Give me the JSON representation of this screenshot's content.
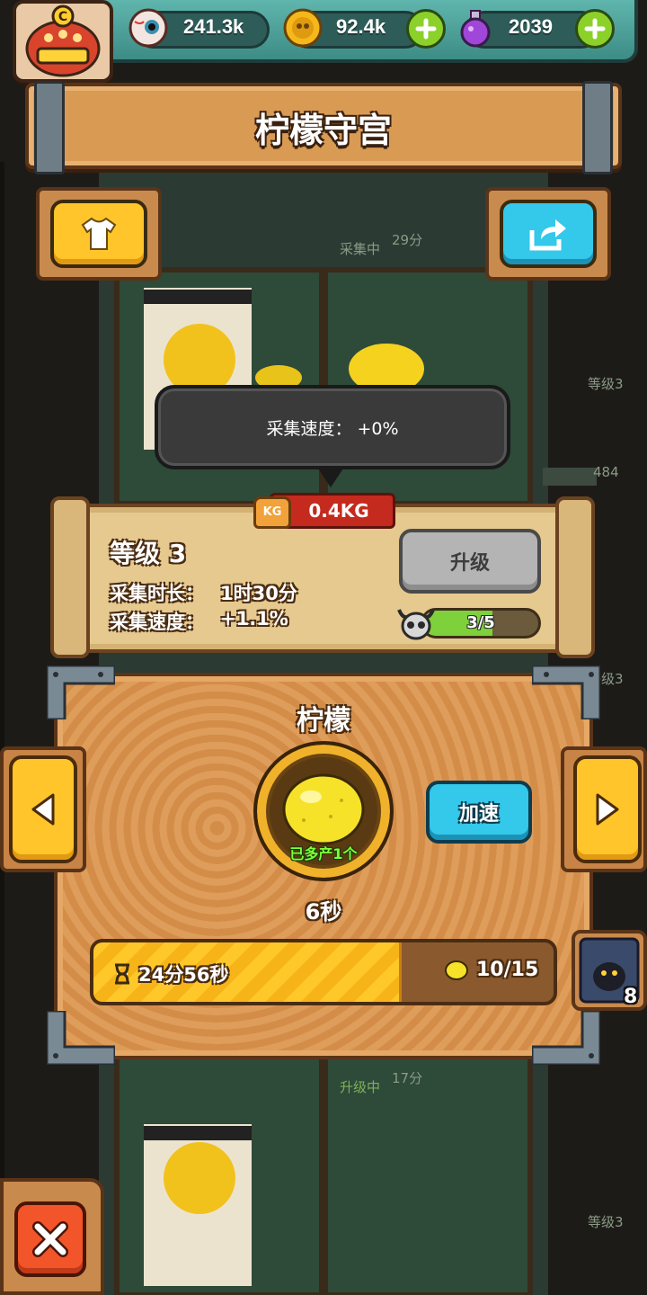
{
  "resources": {
    "eyeballs": "241.3k",
    "coins": "92.4k",
    "potions": "2039"
  },
  "banner": {
    "title": "柠檬守宫"
  },
  "background_labels": {
    "collecting_status": "采集中",
    "collecting_time": "29分",
    "upgrading_status": "升级中",
    "upgrading_time": "17分",
    "side_level_1": "等级3",
    "side_value": "484",
    "side_level_2": "等级3",
    "side_level_3": "等级3"
  },
  "tooltip": {
    "text": "采集速度：  +0%"
  },
  "level_panel": {
    "yield": "0.4KG",
    "kg_icon_label": "KG",
    "level": "等级 3",
    "duration_label": "采集时长：",
    "duration_value": "1时30分",
    "speed_label": "采集速度：",
    "speed_value": "+1.1%",
    "upgrade_label": "升级",
    "progress_text": "3/5",
    "progress_fraction": 0.6
  },
  "production": {
    "item_name": "柠檬",
    "bonus_text": "已多产1个",
    "speed_up_label": "加速",
    "cycle_timer": "6秒",
    "total_time": "24分56秒",
    "count": "10/15",
    "progress_fraction": 0.67
  },
  "side_card": {
    "count": "8"
  },
  "colors": {
    "accent_yellow": "#ffc52a",
    "accent_blue": "#34c8ea",
    "close_red": "#f2552a",
    "plus_green": "#8bd12a"
  },
  "icons": {
    "avatar": "monster-avatar-icon",
    "eyeball": "eyeball-icon",
    "coin": "coin-icon",
    "potion": "potion-icon",
    "plus": "plus-icon",
    "shirt": "shirt-icon",
    "share": "share-icon",
    "skull": "horned-skull-icon",
    "hourglass": "hourglass-icon",
    "lemon": "lemon-icon",
    "arrow_left": "arrow-left-icon",
    "arrow_right": "arrow-right-icon",
    "close": "close-icon"
  }
}
